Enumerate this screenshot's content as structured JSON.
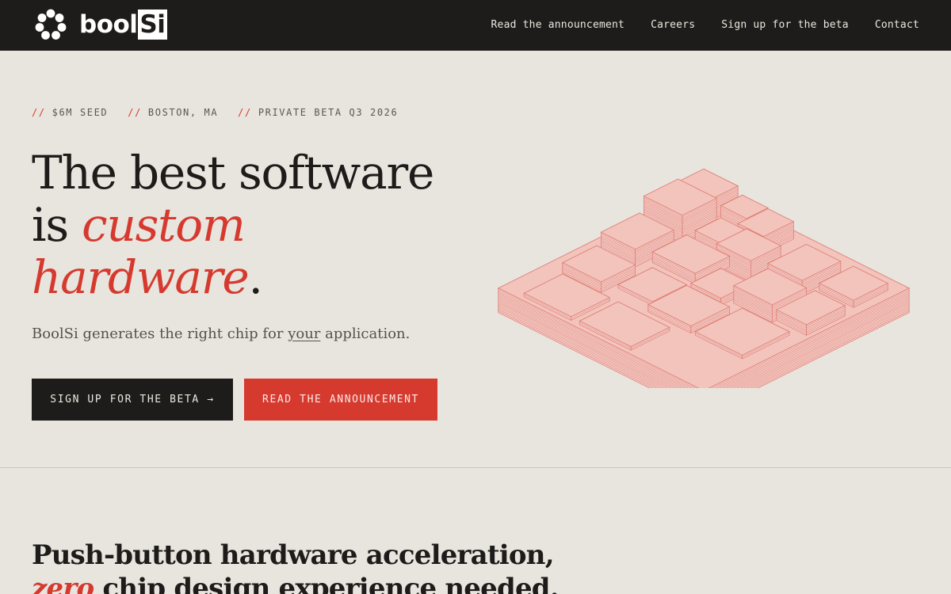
{
  "brand": {
    "name_part1": "bool",
    "name_part2": "Si"
  },
  "nav": {
    "links": [
      {
        "label": "Read the announcement"
      },
      {
        "label": "Careers"
      },
      {
        "label": "Sign up for the beta"
      },
      {
        "label": "Contact"
      }
    ]
  },
  "hero": {
    "tags": [
      {
        "prefix": "//",
        "text": "$6M SEED"
      },
      {
        "prefix": "//",
        "text": "BOSTON, MA"
      },
      {
        "prefix": "//",
        "text": "PRIVATE BETA Q3 2026"
      }
    ],
    "headline": {
      "line1": "The best software",
      "line2_plain": "is ",
      "line2_accent": "custom",
      "line3_accent": "hardware",
      "line3_end": "."
    },
    "lede": {
      "before": "BoolSi generates the right chip for ",
      "underlined": "your",
      "after": " application."
    },
    "primary_button": "SIGN UP FOR THE BETA →",
    "secondary_button": "READ THE ANNOUNCEMENT"
  },
  "section": {
    "title_line1": "Push-button hardware acceleration,",
    "title_line2_accent": "zero",
    "title_line2_rest": " chip design experience needed."
  },
  "colors": {
    "accent": "#d63a2f",
    "nav_bg": "#1e1c1a",
    "page_bg": "#e8e5de",
    "chip_fill": "#f2c4bc"
  },
  "icons": {
    "logo": "chip-ring-logo-icon",
    "button_arrow": "arrow-right"
  }
}
